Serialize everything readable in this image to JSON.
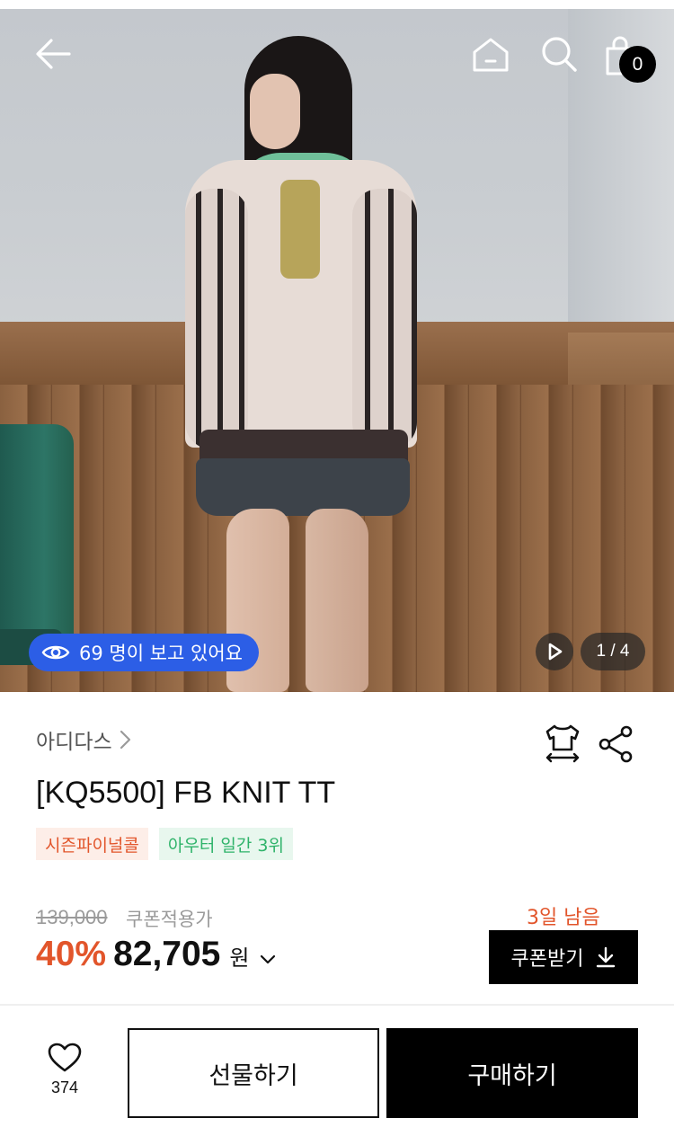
{
  "header": {
    "icons": [
      "back-arrow-icon",
      "home-icon",
      "search-icon",
      "shopping-bag-icon"
    ],
    "cart_count": "0"
  },
  "gallery": {
    "viewers_text": "69 명이 보고 있어요",
    "page_indicator": "1 / 4",
    "icons": [
      "eye-icon",
      "play-icon"
    ]
  },
  "product": {
    "brand": "아디다스",
    "title": "[KQ5500] FB KNIT TT",
    "tags": [
      "시즌파이널콜",
      "아우터 일간 3위"
    ],
    "original_price": "139,000",
    "coupon_applied_label": "쿠폰적용가",
    "discount_rate": "40%",
    "sale_price": "82,705",
    "currency": "원",
    "coupon_days_left": "3일 남음",
    "coupon_button_label": "쿠폰받기"
  },
  "actions": {
    "like_count": "374",
    "gift_label": "선물하기",
    "buy_label": "구매하기"
  },
  "colors": {
    "accent_orange": "#e2552b",
    "rank_green": "#2fb36a",
    "viewers_blue": "#2c5ee6",
    "black": "#000000"
  }
}
